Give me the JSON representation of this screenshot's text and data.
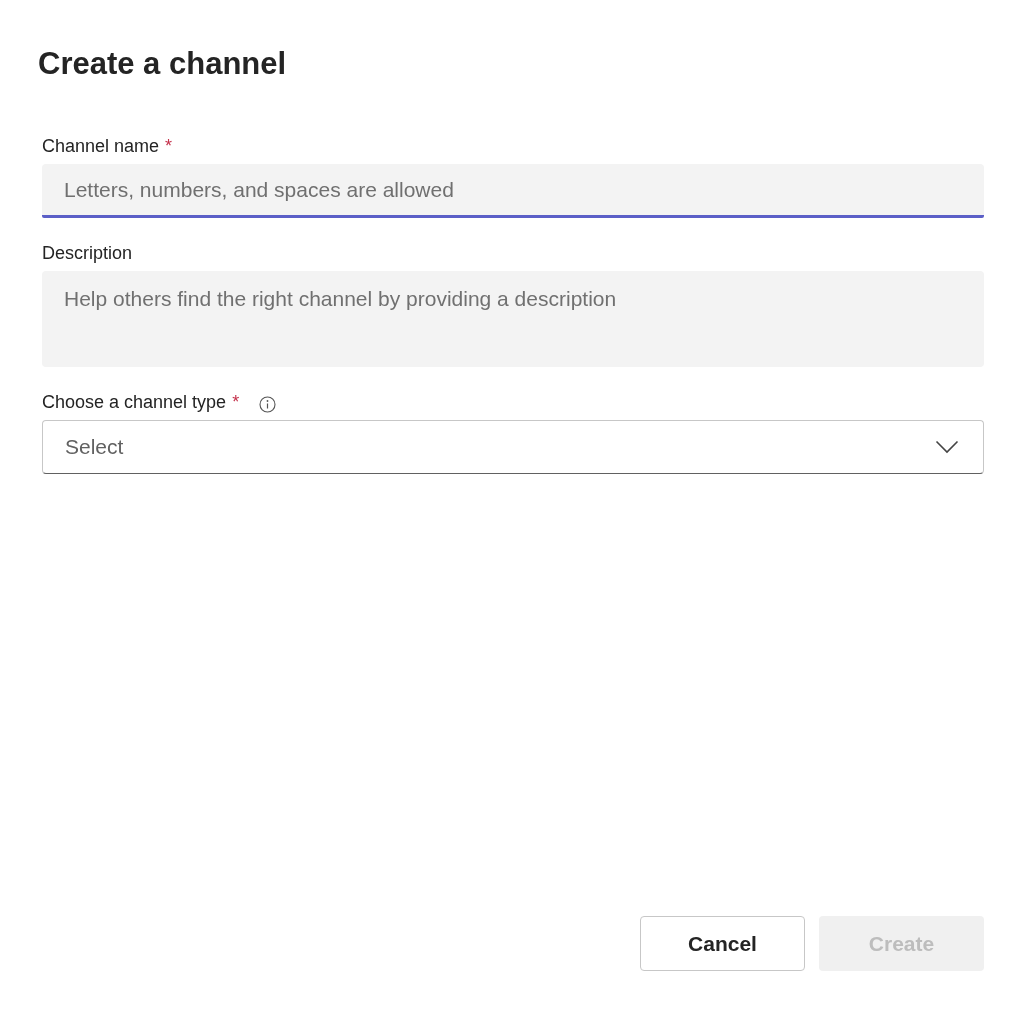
{
  "dialog": {
    "title": "Create a channel"
  },
  "fields": [
    {
      "kind": "text",
      "label": "Channel name",
      "required_mark": "*",
      "placeholder": "Letters, numbers, and spaces are allowed",
      "focused": true
    },
    {
      "kind": "textarea",
      "label": "Description",
      "placeholder": "Help others find the right channel by providing a description",
      "focused": false
    },
    {
      "kind": "select",
      "label": "Choose a channel type",
      "required_mark": "*",
      "info": true,
      "placeholder": "Select",
      "focused": false
    }
  ],
  "buttons": [
    {
      "label": "Cancel",
      "kind": "secondary",
      "disabled": false
    },
    {
      "label": "Create",
      "kind": "primary",
      "disabled": true
    }
  ]
}
